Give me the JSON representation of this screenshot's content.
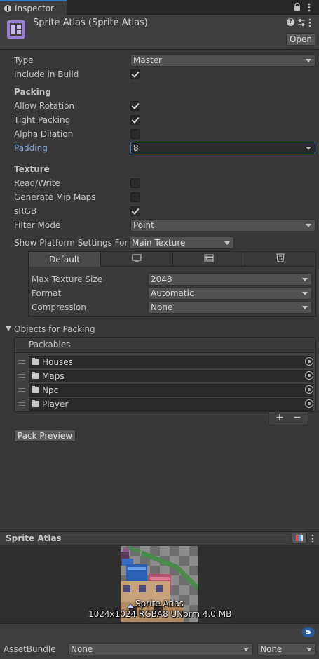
{
  "tab": {
    "title": "Inspector"
  },
  "header": {
    "title": "Sprite Atlas (Sprite Atlas)",
    "open_label": "Open"
  },
  "fields": {
    "type_label": "Type",
    "type_value": "Master",
    "include_label": "Include in Build",
    "include_checked": true,
    "packing_title": "Packing",
    "allow_rotation_label": "Allow Rotation",
    "allow_rotation_checked": true,
    "tight_packing_label": "Tight Packing",
    "tight_packing_checked": true,
    "alpha_dilation_label": "Alpha Dilation",
    "alpha_dilation_checked": false,
    "padding_label": "Padding",
    "padding_value": "8",
    "texture_title": "Texture",
    "read_write_label": "Read/Write",
    "read_write_checked": false,
    "mip_maps_label": "Generate Mip Maps",
    "mip_maps_checked": false,
    "srgb_label": "sRGB",
    "srgb_checked": true,
    "filter_mode_label": "Filter Mode",
    "filter_mode_value": "Point",
    "platform_settings_label": "Show Platform Settings For",
    "platform_settings_value": "Main Texture"
  },
  "platform": {
    "tabs": [
      {
        "label": "Default",
        "icon": ""
      },
      {
        "label": "",
        "icon": "monitor-icon"
      },
      {
        "label": "",
        "icon": "server-icon"
      },
      {
        "label": "",
        "icon": "html5-icon"
      }
    ],
    "max_size_label": "Max Texture Size",
    "max_size_value": "2048",
    "format_label": "Format",
    "format_value": "Automatic",
    "compression_label": "Compression",
    "compression_value": "None"
  },
  "objects": {
    "title": "Objects for Packing",
    "list_header": "Packables",
    "items": [
      "Houses",
      "Maps",
      "Npc",
      "Player"
    ],
    "add_label": "+",
    "remove_label": "−"
  },
  "pack_preview_label": "Pack Preview",
  "preview": {
    "title": "Sprite Atlas",
    "overlay_name": "Sprite Atlas",
    "info": "1024x1024 RGBA8 UNorm   4.0 MB"
  },
  "asset_bundle": {
    "label": "AssetBundle",
    "name_value": "None",
    "variant_value": "None"
  },
  "colors": {
    "accent": "#3a79bb",
    "padding_label": "#7ea8dc"
  }
}
